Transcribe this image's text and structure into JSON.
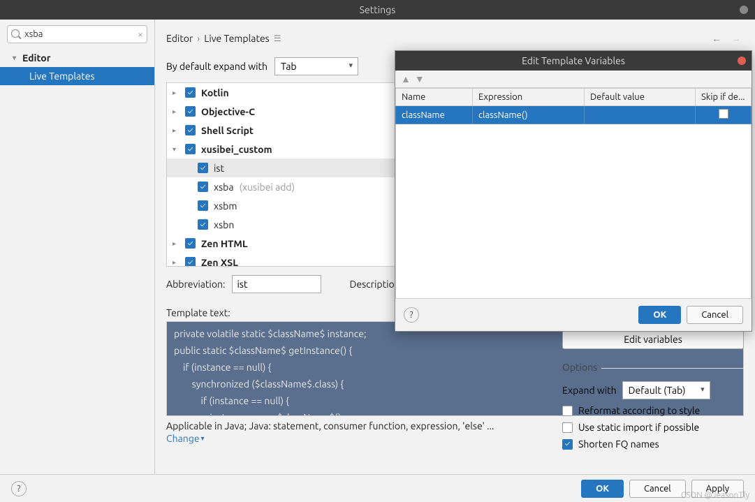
{
  "window": {
    "title": "Settings"
  },
  "sidebar": {
    "search_value": "xsba",
    "search_placeholder": "",
    "items": [
      "Editor",
      "Live Templates"
    ],
    "selected_index": 1
  },
  "breadcrumb": {
    "part1": "Editor",
    "part2": "Live Templates"
  },
  "expand": {
    "label": "By default expand with",
    "value": "Tab"
  },
  "template_groups": [
    {
      "label": "Kotlin",
      "checked": true,
      "expanded": false
    },
    {
      "label": "Objective-C",
      "checked": true,
      "expanded": false
    },
    {
      "label": "Shell Script",
      "checked": true,
      "expanded": false
    },
    {
      "label": "xusibei_custom",
      "checked": true,
      "expanded": true,
      "children": [
        {
          "label": "ist",
          "checked": true,
          "hint": "",
          "selected": true
        },
        {
          "label": "xsba",
          "checked": true,
          "hint": "(xusibei add)"
        },
        {
          "label": "xsbm",
          "checked": true,
          "hint": ""
        },
        {
          "label": "xsbn",
          "checked": true,
          "hint": ""
        }
      ]
    },
    {
      "label": "Zen HTML",
      "checked": true,
      "expanded": false
    },
    {
      "label": "Zen XSL",
      "checked": true,
      "expanded": false
    }
  ],
  "form": {
    "abbrev_label": "Abbreviation:",
    "abbrev_value": "ist",
    "desc_label": "Description:",
    "desc_value": "",
    "tpltext_label": "Template text:",
    "code_lines": [
      "private volatile static $className$ instance;",
      "public static $className$ getInstance() {",
      "    if (instance == null) {",
      "        synchronized ($className$.class) {",
      "            if (instance == null) {",
      "                instance = new $className$();"
    ],
    "applicable": "Applicable in Java; Java: statement, consumer function, expression, 'else' ...",
    "change": "Change"
  },
  "right": {
    "editvars_label": "Edit variables",
    "options_title": "Options",
    "expandwith_label": "Expand with",
    "expandwith_value": "Default (Tab)",
    "opt_reformat": "Reformat according to style",
    "opt_static": "Use static import if possible",
    "opt_shorten": "Shorten FQ names"
  },
  "footer": {
    "ok": "OK",
    "cancel": "Cancel",
    "apply": "Apply"
  },
  "dialog": {
    "title": "Edit Template Variables",
    "cols": {
      "name": "Name",
      "expr": "Expression",
      "def": "Default value",
      "skip": "Skip if de..."
    },
    "row": {
      "name": "className",
      "expr": "className()",
      "def": "",
      "skip": false
    },
    "ok": "OK",
    "cancel": "Cancel"
  },
  "watermark": "CSDN @JeasonTly"
}
